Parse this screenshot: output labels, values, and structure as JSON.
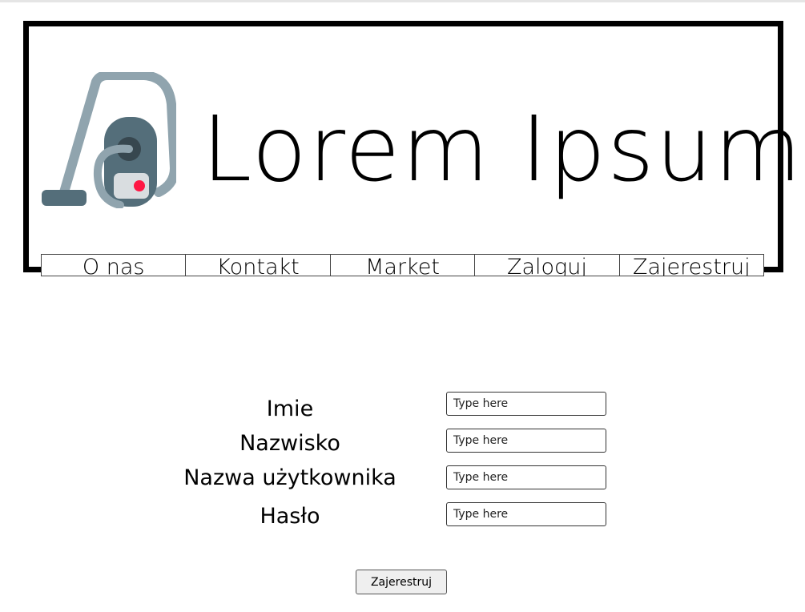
{
  "header": {
    "brand_name": "Lorem Ipsum",
    "logo_icon": "vacuum-cleaner-icon"
  },
  "nav": {
    "items": [
      {
        "label": "O nas"
      },
      {
        "label": "Kontakt"
      },
      {
        "label": "Market"
      },
      {
        "label": "Zaloguj"
      },
      {
        "label": "Zajerestruj"
      }
    ]
  },
  "form": {
    "fields": [
      {
        "label": "Imie",
        "placeholder": "Type here"
      },
      {
        "label": "Nazwisko",
        "placeholder": "Type here"
      },
      {
        "label": "Nazwa użytkownika",
        "placeholder": "Type here"
      },
      {
        "label": "Hasło",
        "placeholder": "Type here"
      }
    ],
    "submit_label": "Zajerestruj"
  },
  "colors": {
    "logo_light": "#90a4ae",
    "logo_dark": "#546e7a",
    "logo_panel": "#d9dde0",
    "logo_dot": "#ff1744"
  }
}
